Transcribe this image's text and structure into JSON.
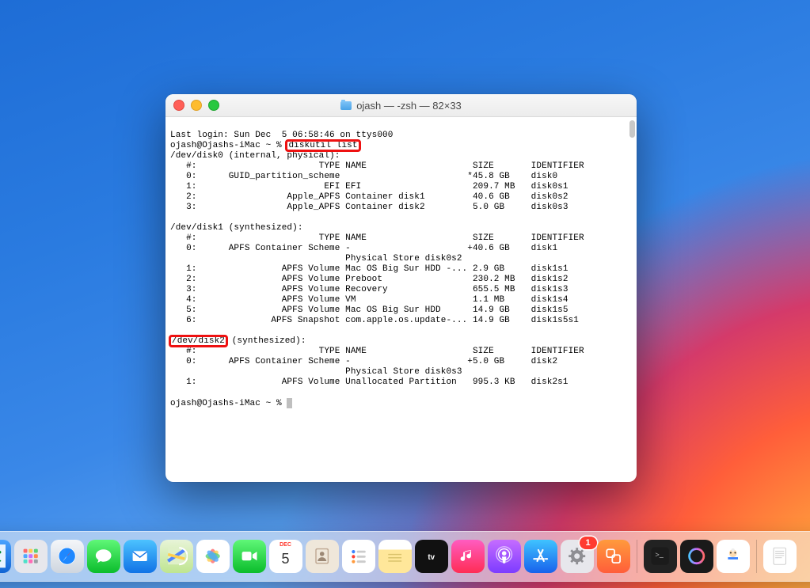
{
  "window": {
    "title": "ojash — -zsh — 82×33",
    "last_login": "Last login: Sun Dec  5 06:58:46 on ttys000",
    "prompt": "ojash@Ojashs-iMac ~ % ",
    "command": "diskutil list",
    "highlight_command": "diskutil list",
    "highlight_disk2": "/dev/disk2"
  },
  "disk0": {
    "header": "/dev/disk0 (internal, physical):",
    "cols": "   #:                       TYPE NAME                    SIZE       IDENTIFIER",
    "rows": [
      "   0:      GUID_partition_scheme                        *45.8 GB    disk0",
      "   1:                        EFI EFI                     209.7 MB   disk0s1",
      "   2:                 Apple_APFS Container disk1         40.6 GB    disk0s2",
      "   3:                 Apple_APFS Container disk2         5.0 GB     disk0s3"
    ]
  },
  "disk1": {
    "header": "/dev/disk1 (synthesized):",
    "cols": "   #:                       TYPE NAME                    SIZE       IDENTIFIER",
    "rows": [
      "   0:      APFS Container Scheme -                      +40.6 GB    disk1",
      "                                 Physical Store disk0s2",
      "   1:                APFS Volume Mac OS Big Sur HDD -... 2.9 GB     disk1s1",
      "   2:                APFS Volume Preboot                 230.2 MB   disk1s2",
      "   3:                APFS Volume Recovery                655.5 MB   disk1s3",
      "   4:                APFS Volume VM                      1.1 MB     disk1s4",
      "   5:                APFS Volume Mac OS Big Sur HDD      14.9 GB    disk1s5",
      "   6:              APFS Snapshot com.apple.os.update-... 14.9 GB    disk1s5s1"
    ]
  },
  "disk2": {
    "header_rest": " (synthesized):",
    "cols": "   #:                       TYPE NAME                    SIZE       IDENTIFIER",
    "rows": [
      "   0:      APFS Container Scheme -                      +5.0 GB     disk2",
      "                                 Physical Store disk0s3",
      "   1:                APFS Volume Unallocated Partition   995.3 KB   disk2s1"
    ]
  },
  "calendar": {
    "month": "DEC",
    "day": "5"
  },
  "prefs_badge": "1",
  "dock_names": {
    "finder": "finder",
    "launchpad": "launchpad",
    "safari": "safari",
    "messages": "messages",
    "mail": "mail",
    "maps": "maps",
    "photos": "photos",
    "facetime": "facetime",
    "calendar": "calendar",
    "contacts": "contacts",
    "reminders": "reminders",
    "notes": "notes",
    "tv": "tv",
    "music": "music",
    "podcasts": "podcasts",
    "appstore": "app-store",
    "prefs": "system-preferences",
    "vm": "vmware",
    "terminal": "terminal",
    "cleanmac": "cleanmymac",
    "doctor": "dr-cleaner",
    "textedit": "textedit-doc",
    "trash": "trash"
  }
}
